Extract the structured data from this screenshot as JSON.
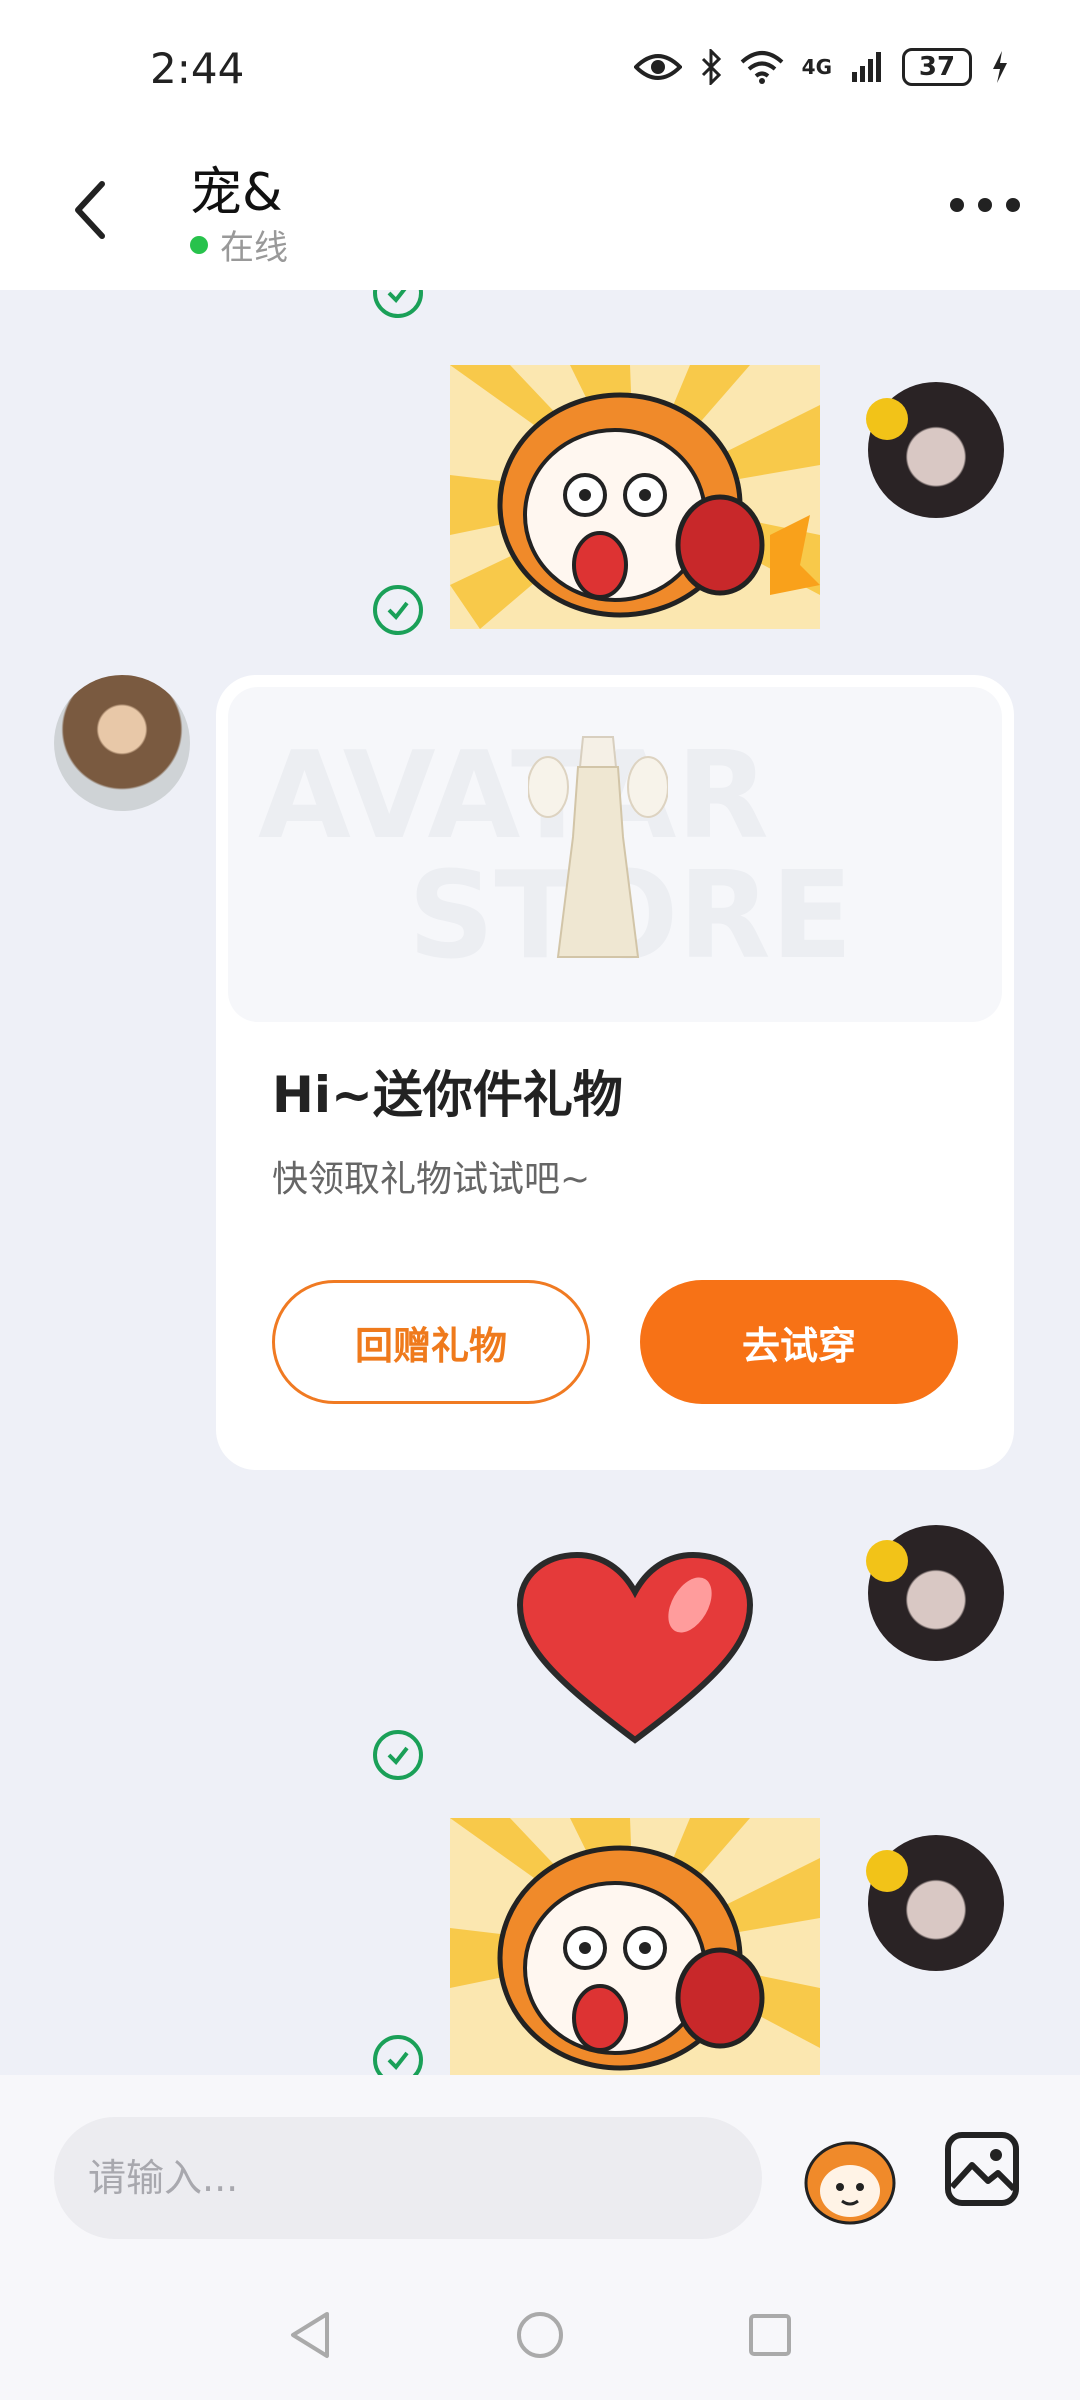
{
  "status_bar": {
    "time": "2:44",
    "network": "4G",
    "battery": "37"
  },
  "header": {
    "contact_name": "宠&",
    "status_text": "在线"
  },
  "gift_card": {
    "banner_watermark_1": "AVATAR",
    "banner_watermark_2": "STORE",
    "title": "Hi~送你件礼物",
    "subtitle": "快领取礼物试试吧~",
    "return_gift_label": "回赠礼物",
    "try_on_label": "去试穿"
  },
  "input": {
    "placeholder": "请输入..."
  },
  "colors": {
    "accent": "#f77216",
    "online": "#27c24c",
    "check": "#1aa058"
  }
}
